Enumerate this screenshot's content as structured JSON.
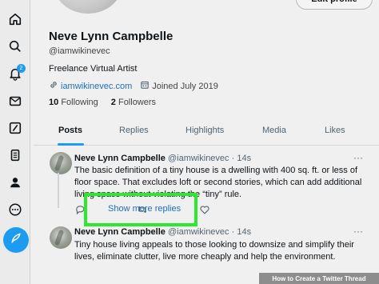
{
  "profile": {
    "edit_label": "Edit profile",
    "name": "Neve Lynn Campbelle",
    "handle": "@iamwikinevec",
    "bio": "Freelance Virtual Artist",
    "website": "iamwikinevec.com",
    "joined": "Joined July 2019",
    "following_count": "10",
    "following_label": "Following",
    "followers_count": "2",
    "followers_label": "Followers"
  },
  "sidebar": {
    "notification_badge": "2",
    "icons": [
      "home-icon",
      "search-icon",
      "notifications-icon",
      "messages-icon",
      "grok-icon",
      "lists-icon",
      "profile-icon",
      "more-icon",
      "compose-post-icon"
    ]
  },
  "tabs": [
    "Posts",
    "Replies",
    "Highlights",
    "Media",
    "Likes"
  ],
  "posts": [
    {
      "name": "Neve Lynn Campbelle",
      "handle": "@iamwikinevec",
      "time": "· 14s",
      "text": "The basic definition of a tiny house is a dwelling with 400 sq. ft. or less of floor space. That excludes loft or second stories, which can add additional living space without violating the “tiny” rule."
    },
    {
      "name": "Neve Lynn Campbelle",
      "handle": "@iamwikinevec",
      "time": "· 14s",
      "text": "Tiny house living appeals to those looking to downsize and simplify their lives, eliminate clutter, live more cheaply and help the environment."
    }
  ],
  "show_more_replies": "Show more replies",
  "watermark": "How to Create a Twitter Thread",
  "colors": {
    "accent": "#1d9bf0",
    "highlight": "#2ee82e",
    "link": "#1d6fb8"
  }
}
